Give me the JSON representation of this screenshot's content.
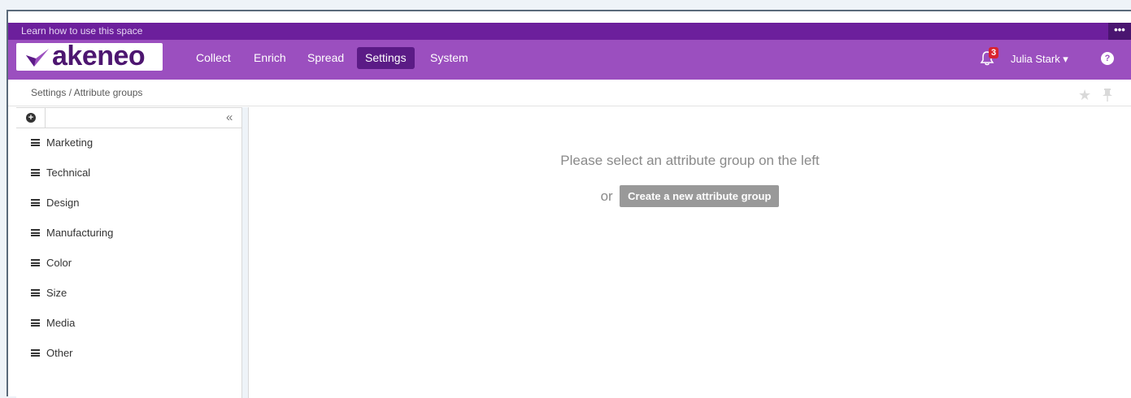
{
  "learn_bar": {
    "text": "Learn how to use this space",
    "menu": "•••"
  },
  "logo": {
    "text": "akeneo"
  },
  "nav": {
    "items": [
      {
        "label": "Collect"
      },
      {
        "label": "Enrich"
      },
      {
        "label": "Spread"
      },
      {
        "label": "Settings",
        "active": true
      },
      {
        "label": "System"
      }
    ]
  },
  "notifications": {
    "count": "3"
  },
  "user": {
    "name": "Julia Stark ▾"
  },
  "help": {
    "label": "?"
  },
  "breadcrumb": {
    "text": "Settings / Attribute groups"
  },
  "sidebar": {
    "add_label": "+",
    "collapse_label": "«",
    "groups": [
      {
        "label": "Marketing"
      },
      {
        "label": "Technical"
      },
      {
        "label": "Design"
      },
      {
        "label": "Manufacturing"
      },
      {
        "label": "Color"
      },
      {
        "label": "Size"
      },
      {
        "label": "Media"
      },
      {
        "label": "Other"
      }
    ]
  },
  "main": {
    "empty_message": "Please select an attribute group on the left",
    "or": "or",
    "create_button": "Create a new attribute group"
  },
  "colors": {
    "learn_bar": "#6c1f9c",
    "navbar": "#9b4fbf",
    "nav_active": "#5b1b86",
    "badge": "#d9232e",
    "create_button": "#999999"
  }
}
